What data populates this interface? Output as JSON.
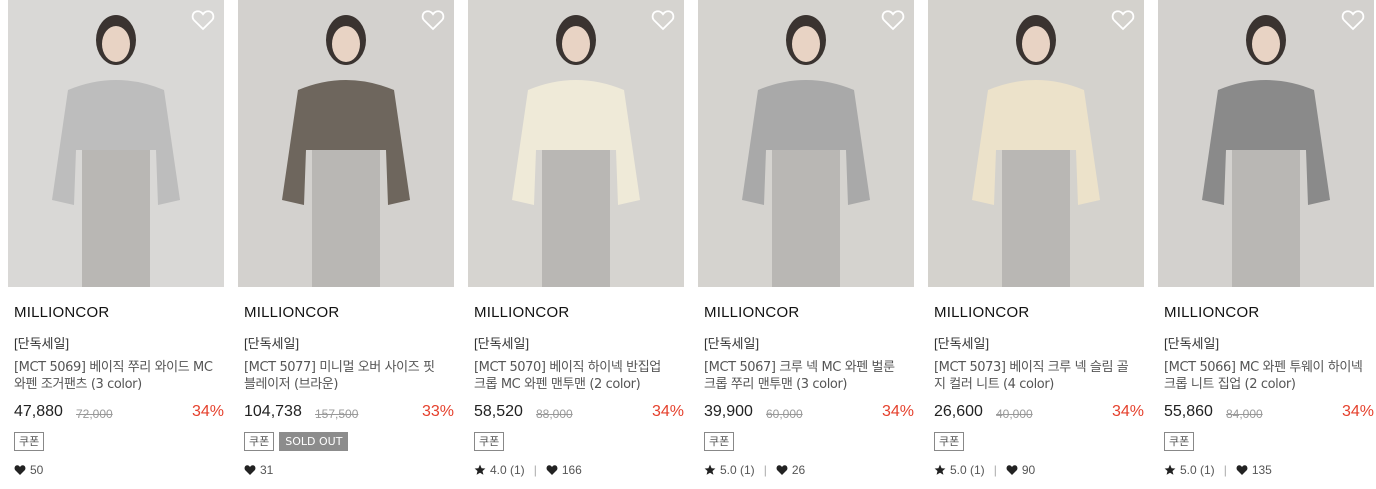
{
  "products": [
    {
      "brand": "MILLIONCOR",
      "tag": "[단독세일]",
      "name": "[MCT 5069] 베이직 쭈리 와이드 MC 와펜 조거팬츠 (3 color)",
      "price": "47,880",
      "original_price": "72,000",
      "discount": "34%",
      "coupon": "쿠폰",
      "sold_out": "",
      "rating": "",
      "likes": "50",
      "bg": "#d9d8d6",
      "garment": "#bdbdbd"
    },
    {
      "brand": "MILLIONCOR",
      "tag": "[단독세일]",
      "name": "[MCT 5077] 미니멀 오버 사이즈 핏 블레이저 (브라운)",
      "price": "104,738",
      "original_price": "157,500",
      "discount": "33%",
      "coupon": "쿠폰",
      "sold_out": "SOLD OUT",
      "rating": "",
      "likes": "31",
      "bg": "#d3d1ce",
      "garment": "#6e665d"
    },
    {
      "brand": "MILLIONCOR",
      "tag": "[단독세일]",
      "name": "[MCT 5070] 베이직 하이넥 반집업 크롭 MC 와펜 맨투맨 (2 color)",
      "price": "58,520",
      "original_price": "88,000",
      "discount": "34%",
      "coupon": "쿠폰",
      "sold_out": "",
      "rating": "4.0 (1)",
      "likes": "166",
      "bg": "#d6d4d0",
      "garment": "#efead8"
    },
    {
      "brand": "MILLIONCOR",
      "tag": "[단독세일]",
      "name": "[MCT 5067] 크루 넥 MC 와펜 벌룬 크롭 쭈리 맨투맨 (3 color)",
      "price": "39,900",
      "original_price": "60,000",
      "discount": "34%",
      "coupon": "쿠폰",
      "sold_out": "",
      "rating": "5.0 (1)",
      "likes": "26",
      "bg": "#d5d3cf",
      "garment": "#a9a9a9"
    },
    {
      "brand": "MILLIONCOR",
      "tag": "[단독세일]",
      "name": "[MCT 5073] 베이직 크루 넥 슬림 골지 컬러 니트 (4 color)",
      "price": "26,600",
      "original_price": "40,000",
      "discount": "34%",
      "coupon": "쿠폰",
      "sold_out": "",
      "rating": "5.0 (1)",
      "likes": "90",
      "bg": "#d4d2cd",
      "garment": "#ece2ca"
    },
    {
      "brand": "MILLIONCOR",
      "tag": "[단독세일]",
      "name": "[MCT 5066] MC 와펜 투웨이 하이넥 크롭 니트 집업 (2 color)",
      "price": "55,860",
      "original_price": "84,000",
      "discount": "34%",
      "coupon": "쿠폰",
      "sold_out": "",
      "rating": "5.0 (1)",
      "likes": "135",
      "bg": "#d3d1ce",
      "garment": "#8a8a8a"
    }
  ]
}
